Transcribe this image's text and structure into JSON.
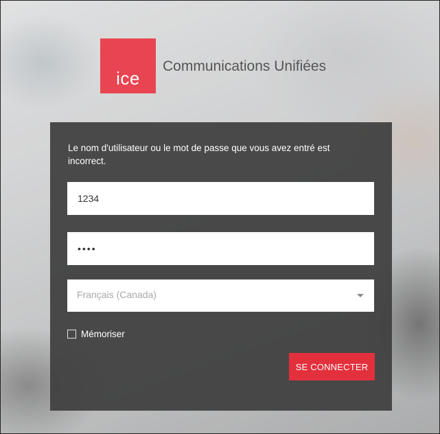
{
  "brand": {
    "logo_text": "ice",
    "title": "Communications Unifiées",
    "accent_color": "#e84451"
  },
  "login": {
    "error_message": "Le nom d'utilisateur ou le mot de passe que vous avez entré est incorrect.",
    "username_value": "1234",
    "password_value": "1234",
    "language_value": "Français (Canada)",
    "remember_label": "Mémoriser",
    "remember_checked": false,
    "submit_label": "SE CONNECTER",
    "submit_color": "#e3303d"
  }
}
